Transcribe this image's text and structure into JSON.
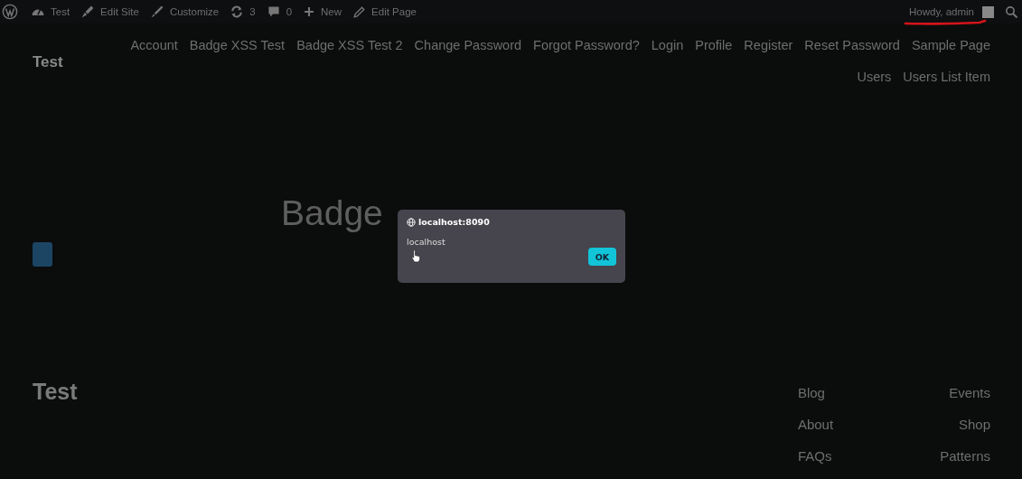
{
  "admin_bar": {
    "items": [
      {
        "kind": "logo"
      },
      {
        "kind": "dashboard",
        "label": "Test"
      },
      {
        "kind": "edit-site",
        "label": "Edit Site"
      },
      {
        "kind": "customize",
        "label": "Customize"
      },
      {
        "kind": "updates",
        "label": "3"
      },
      {
        "kind": "comments",
        "label": "0"
      },
      {
        "kind": "new",
        "label": "New"
      },
      {
        "kind": "edit",
        "label": "Edit Page"
      }
    ],
    "greeting": "Howdy, admin"
  },
  "site_title": "Test",
  "nav": [
    "Account",
    "Badge XSS Test",
    "Badge XSS Test 2",
    "Change Password",
    "Forgot Password?",
    "Login",
    "Profile",
    "Register",
    "Reset Password",
    "Sample Page",
    "Users",
    "Users List Item"
  ],
  "page_title": "Badge",
  "dialog": {
    "origin": "localhost:8090",
    "message": "localhost",
    "button": "OK"
  },
  "footer": {
    "title": "Test",
    "column_1": [
      "Blog",
      "About",
      "FAQs"
    ],
    "column_2": [
      "Events",
      "Shop",
      "Patterns"
    ]
  }
}
